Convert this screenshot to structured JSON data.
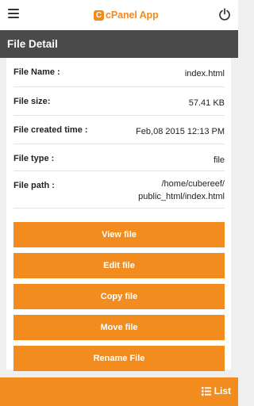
{
  "header": {
    "logo_letter": "C",
    "app_name": "cPanel App",
    "menu_icon": "hamburger-icon",
    "power_icon": "power-icon"
  },
  "page_title": "File Detail",
  "details": [
    {
      "label": "File Name :",
      "value": "index.html"
    },
    {
      "label": "File size:",
      "value": "57.41 KB"
    },
    {
      "label": "File created time :",
      "value": "Feb,08 2015 12:13 PM"
    },
    {
      "label": "File type :",
      "value": "file"
    },
    {
      "label": "File path :",
      "value_line1": "/home/cubereef/",
      "value_line2": "public_html/index.html"
    }
  ],
  "actions": {
    "view": "View file",
    "edit": "Edit file",
    "copy": "Copy file",
    "move": "Move file",
    "rename": "Rename File"
  },
  "footer": {
    "list_label": "List",
    "list_icon": "list-icon"
  },
  "colors": {
    "accent": "#f28c1e",
    "titlebar": "#4a4a4a"
  }
}
